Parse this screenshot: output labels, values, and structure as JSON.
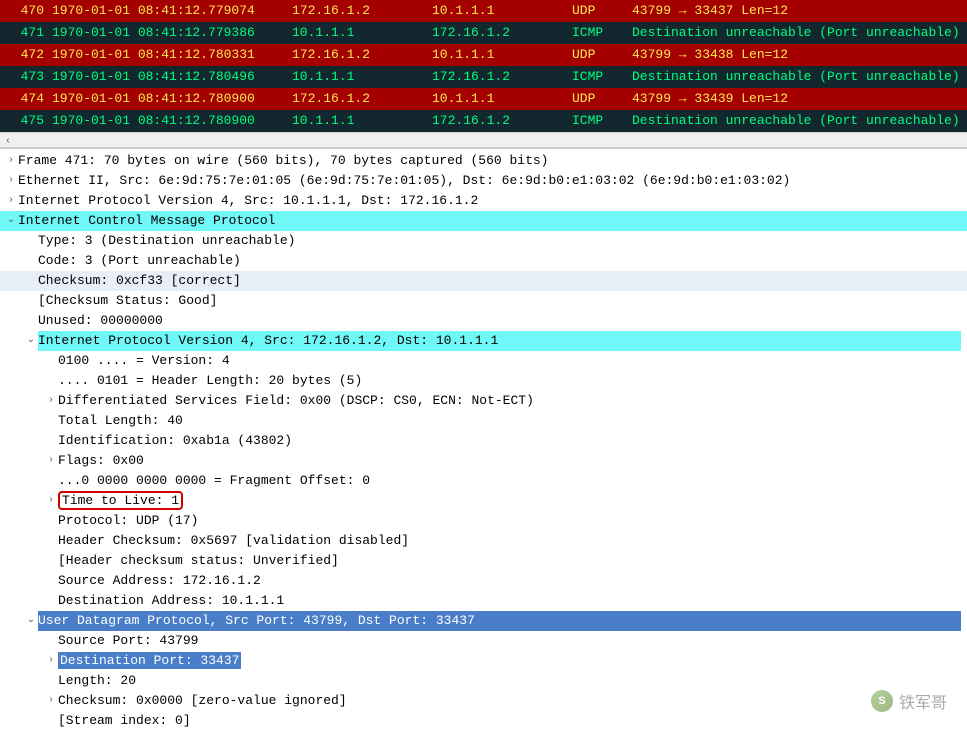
{
  "packets": [
    {
      "no": "470",
      "time": "1970-01-01 08:41:12.779074",
      "src": "172.16.1.2",
      "dst": "10.1.1.1",
      "proto": "UDP",
      "info": "43799 → 33437 Len=12",
      "cls": "row-udp"
    },
    {
      "no": "471",
      "time": "1970-01-01 08:41:12.779386",
      "src": "10.1.1.1",
      "dst": "172.16.1.2",
      "proto": "ICMP",
      "info": "Destination unreachable (Port unreachable)",
      "cls": "row-icmp"
    },
    {
      "no": "472",
      "time": "1970-01-01 08:41:12.780331",
      "src": "172.16.1.2",
      "dst": "10.1.1.1",
      "proto": "UDP",
      "info": "43799 → 33438 Len=12",
      "cls": "row-udp"
    },
    {
      "no": "473",
      "time": "1970-01-01 08:41:12.780496",
      "src": "10.1.1.1",
      "dst": "172.16.1.2",
      "proto": "ICMP",
      "info": "Destination unreachable (Port unreachable)",
      "cls": "row-icmp"
    },
    {
      "no": "474",
      "time": "1970-01-01 08:41:12.780900",
      "src": "172.16.1.2",
      "dst": "10.1.1.1",
      "proto": "UDP",
      "info": "43799 → 33439 Len=12",
      "cls": "row-udp"
    },
    {
      "no": "475",
      "time": "1970-01-01 08:41:12.780900",
      "src": "10.1.1.1",
      "dst": "172.16.1.2",
      "proto": "ICMP",
      "info": "Destination unreachable (Port unreachable)",
      "cls": "row-icmp"
    }
  ],
  "details": {
    "frame": "Frame 471: 70 bytes on wire (560 bits), 70 bytes captured (560 bits)",
    "eth": "Ethernet II, Src: 6e:9d:75:7e:01:05 (6e:9d:75:7e:01:05), Dst: 6e:9d:b0:e1:03:02 (6e:9d:b0:e1:03:02)",
    "ip": "Internet Protocol Version 4, Src: 10.1.1.1, Dst: 172.16.1.2",
    "icmp": "Internet Control Message Protocol",
    "icmp_type": "Type: 3 (Destination unreachable)",
    "icmp_code": "Code: 3 (Port unreachable)",
    "icmp_chk": "Checksum: 0xcf33 [correct]",
    "icmp_chkstat": "[Checksum Status: Good]",
    "icmp_unused": "Unused: 00000000",
    "inner_ip": "Internet Protocol Version 4, Src: 172.16.1.2, Dst: 10.1.1.1",
    "inner_ver": "0100 .... = Version: 4",
    "inner_hlen": ".... 0101 = Header Length: 20 bytes (5)",
    "inner_dscp": "Differentiated Services Field: 0x00 (DSCP: CS0, ECN: Not-ECT)",
    "inner_totlen": "Total Length: 40",
    "inner_id": "Identification: 0xab1a (43802)",
    "inner_flags": "Flags: 0x00",
    "inner_fragoff": "...0 0000 0000 0000 = Fragment Offset: 0",
    "inner_ttl": "Time to Live: 1",
    "inner_proto": "Protocol: UDP (17)",
    "inner_hdrchk": "Header Checksum: 0x5697 [validation disabled]",
    "inner_hdrchkstat": "[Header checksum status: Unverified]",
    "inner_srcaddr": "Source Address: 172.16.1.2",
    "inner_dstaddr": "Destination Address: 10.1.1.1",
    "udp": "User Datagram Protocol, Src Port: 43799, Dst Port: 33437",
    "udp_srcport": "Source Port: 43799",
    "udp_dstport": "Destination Port: 33437",
    "udp_len": "Length: 20",
    "udp_chk": "Checksum: 0x0000 [zero-value ignored]",
    "udp_stream": "[Stream index: 0]"
  },
  "glyphs": {
    "right": "›",
    "down": "⌄",
    "left_arrow": "‹"
  },
  "watermark": {
    "icon": "S",
    "text": "铁军哥"
  }
}
